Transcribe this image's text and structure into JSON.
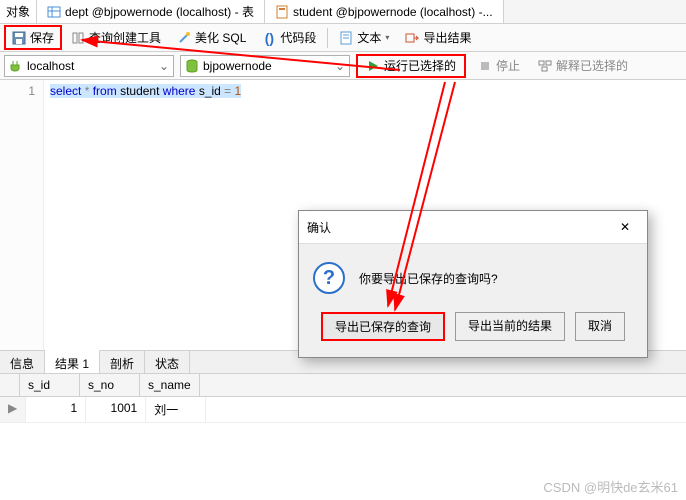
{
  "top_tabs": {
    "objects": "对象",
    "dept": "dept @bjpowernode (localhost) - 表",
    "student": "student @bjpowernode (localhost) -..."
  },
  "toolbar": {
    "save": "保存",
    "query_builder": "查询创建工具",
    "beautify": "美化 SQL",
    "snippet": "代码段",
    "text": "文本",
    "export": "导出结果"
  },
  "connections": {
    "host": "localhost",
    "db": "bjpowernode"
  },
  "run": {
    "run_selected": "运行已选择的",
    "stop": "停止",
    "explain": "解释已选择的"
  },
  "editor": {
    "line": "1",
    "sql_select": "select",
    "sql_star": "*",
    "sql_from": "from",
    "sql_tbl": "student",
    "sql_where": "where",
    "sql_col": "s_id",
    "sql_eq": "=",
    "sql_val": "1"
  },
  "bottom_tabs": {
    "info": "信息",
    "result": "结果 1",
    "profile": "剖析",
    "status": "状态"
  },
  "grid": {
    "cols": [
      "s_id",
      "s_no",
      "s_name"
    ],
    "row_marker": "▶",
    "rows": [
      {
        "s_id": "1",
        "s_no": "1001",
        "s_name": "刘一"
      }
    ]
  },
  "dialog": {
    "title": "确认",
    "msg": "你要导出已保存的查询吗?",
    "b1": "导出已保存的查询",
    "b2": "导出当前的结果",
    "b3": "取消"
  },
  "watermark": "CSDN @明快de玄米61"
}
